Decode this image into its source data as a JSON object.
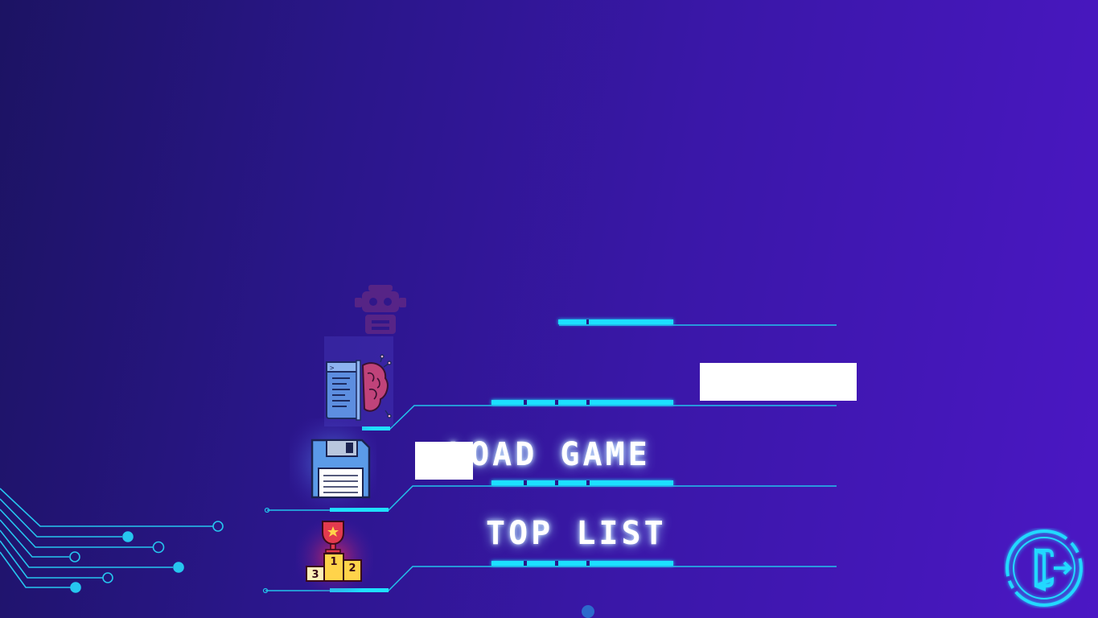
{
  "menu": {
    "items": [
      {
        "id": "new-game",
        "label": "",
        "icon": "robot-icon"
      },
      {
        "id": "ai-mode",
        "label": "",
        "icon": "code-brain-icon"
      },
      {
        "id": "load-game",
        "label": "LOAD GAME",
        "icon": "floppy-disk-icon"
      },
      {
        "id": "top-list",
        "label": "TOP LIST",
        "icon": "podium-trophy-icon"
      }
    ]
  },
  "podium": {
    "first": "1",
    "second": "2",
    "third": "3"
  },
  "exit": {
    "icon": "exit-door-icon"
  },
  "colors": {
    "background_start": "#1c1363",
    "background_end": "#4b17c4",
    "accent_cyan": "#1fe0ff",
    "text": "#ffffff"
  }
}
